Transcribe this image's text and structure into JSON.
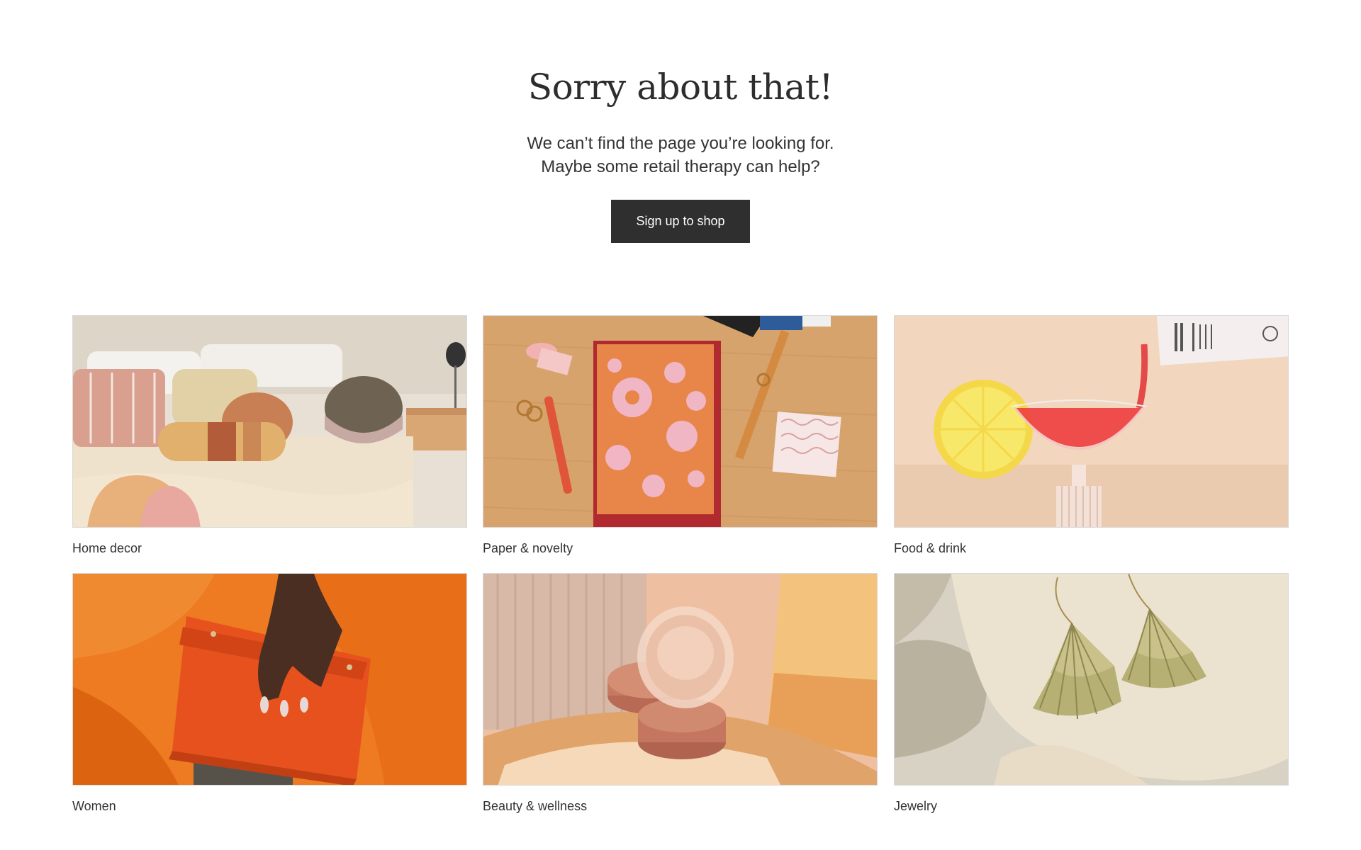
{
  "hero": {
    "title": "Sorry about that!",
    "subtitle_line1": "We can’t find the page you’re looking for.",
    "subtitle_line2": "Maybe some retail therapy can help?",
    "cta_label": "Sign up to shop"
  },
  "categories": [
    {
      "label": "Home decor",
      "image": "bedroom-pillows"
    },
    {
      "label": "Paper & novelty",
      "image": "notebook-desk"
    },
    {
      "label": "Food & drink",
      "image": "cocktail-glass"
    },
    {
      "label": "Women",
      "image": "orange-clutch"
    },
    {
      "label": "Beauty & wellness",
      "image": "glass-jar"
    },
    {
      "label": "Jewelry",
      "image": "gold-earrings"
    }
  ],
  "colors": {
    "button_bg": "#2f2f2f",
    "text": "#333333",
    "background": "#ffffff"
  }
}
